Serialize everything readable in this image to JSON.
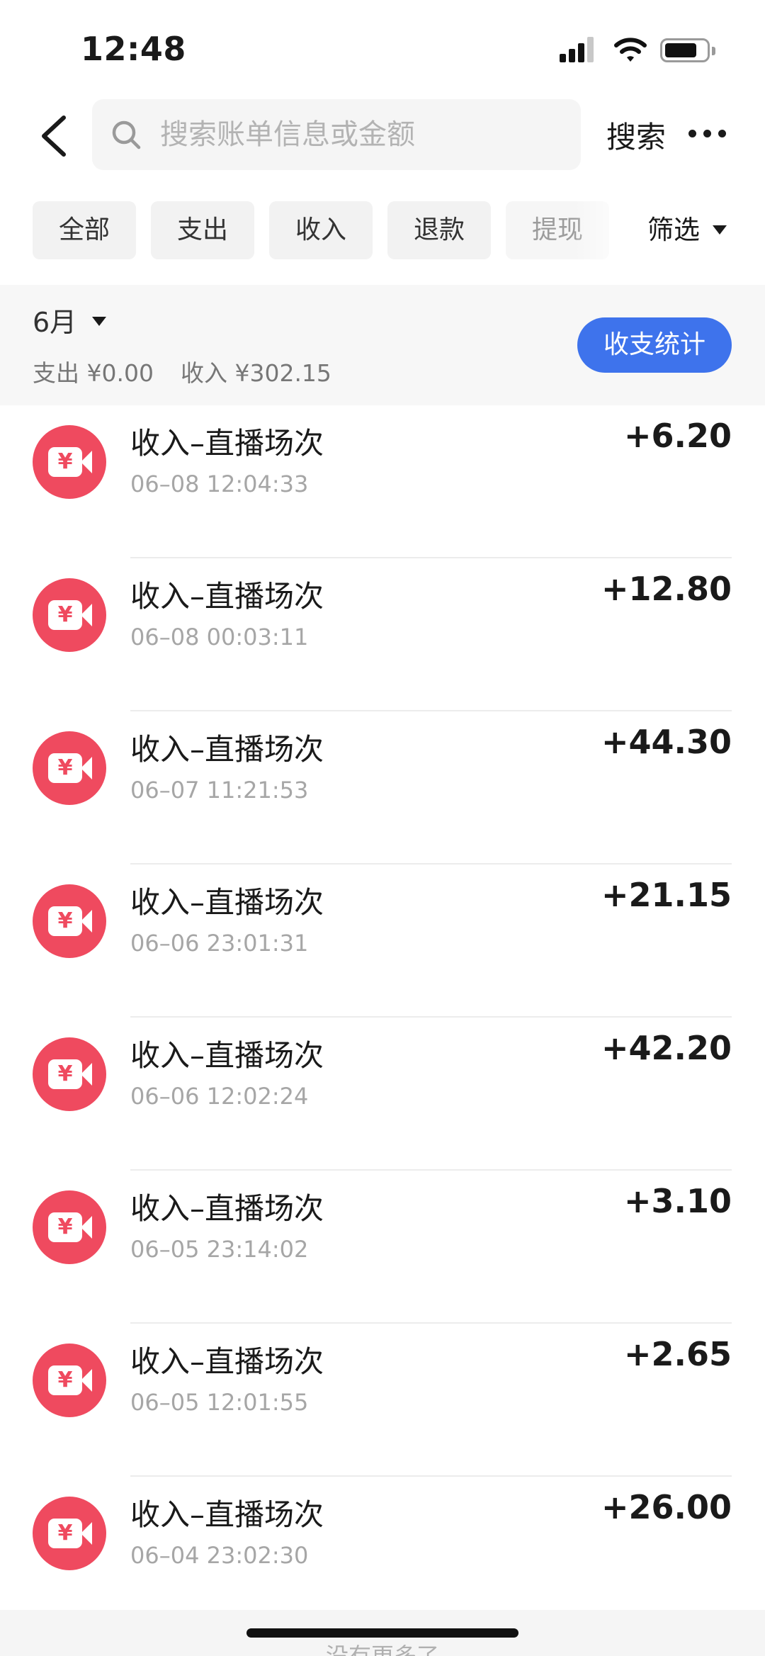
{
  "status_bar": {
    "time": "12:48",
    "icons": [
      "signal-icon",
      "wifi-icon",
      "battery-icon"
    ]
  },
  "header": {
    "back_icon": "chevron-left-icon",
    "search_icon": "search-icon",
    "search_placeholder": "搜索账单信息或金额",
    "search_value": "",
    "search_button": "搜索",
    "more_icon": "more-dots-icon"
  },
  "filters": {
    "chips": [
      "全部",
      "支出",
      "收入",
      "退款",
      "提现"
    ],
    "filter_label": "筛选"
  },
  "summary": {
    "month": "6月",
    "expense": "支出 ¥0.00",
    "income": "收入 ¥302.15",
    "stats_button": "收支统计"
  },
  "records": [
    {
      "title": "收入–直播场次",
      "time": "06–08 12:04:33",
      "amount": "+6.20"
    },
    {
      "title": "收入–直播场次",
      "time": "06–08 00:03:11",
      "amount": "+12.80"
    },
    {
      "title": "收入–直播场次",
      "time": "06–07 11:21:53",
      "amount": "+44.30"
    },
    {
      "title": "收入–直播场次",
      "time": "06–06 23:01:31",
      "amount": "+21.15"
    },
    {
      "title": "收入–直播场次",
      "time": "06–06 12:02:24",
      "amount": "+42.20"
    },
    {
      "title": "收入–直播场次",
      "time": "06–05 23:14:02",
      "amount": "+3.10"
    },
    {
      "title": "收入–直播场次",
      "time": "06–05 12:01:55",
      "amount": "+2.65"
    },
    {
      "title": "收入–直播场次",
      "time": "06–04 23:02:30",
      "amount": "+26.00"
    }
  ],
  "record_icon": {
    "name": "live-income-icon",
    "glyph": "¥"
  },
  "footer": {
    "no_more": "没有更多了"
  },
  "colors": {
    "accent": "#3e73ec",
    "income_icon": "#ef4a5f"
  }
}
